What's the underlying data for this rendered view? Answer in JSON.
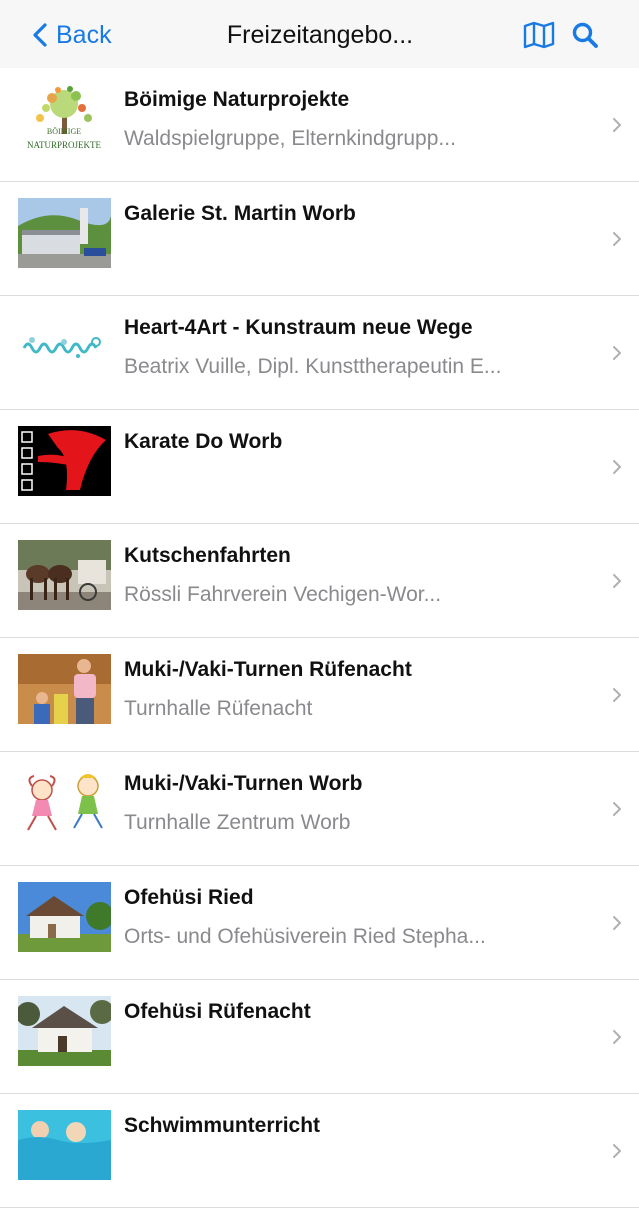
{
  "nav": {
    "back_label": "Back",
    "title": "Freizeitangebo...",
    "accent_color": "#1a7ae4",
    "icons": [
      "back-chevron-icon",
      "map-icon",
      "search-icon"
    ]
  },
  "items": [
    {
      "title": "Böimige Naturprojekte",
      "subtitle": "Waldspielgruppe, Elternkindgrupp...",
      "logo_text": [
        "BÖIMIGE",
        "NATURPROJEKTE"
      ]
    },
    {
      "title": "Galerie St. Martin Worb",
      "subtitle": ""
    },
    {
      "title": "Heart-4Art - Kunstraum neue Wege",
      "subtitle": "Beatrix Vuille, Dipl. Kunsttherapeutin E..."
    },
    {
      "title": "Karate Do Worb",
      "subtitle": ""
    },
    {
      "title": "Kutschenfahrten",
      "subtitle": "Rössli Fahrverein Vechigen-Wor..."
    },
    {
      "title": "Muki-/Vaki-Turnen Rüfenacht",
      "subtitle": "Turnhalle Rüfenacht"
    },
    {
      "title": "Muki-/Vaki-Turnen Worb",
      "subtitle": "Turnhalle Zentrum Worb"
    },
    {
      "title": "Ofehüsi Ried",
      "subtitle": "Orts- und Ofehüsiverein Ried Stepha..."
    },
    {
      "title": "Ofehüsi Rüfenacht",
      "subtitle": ""
    },
    {
      "title": "Schwimmunterricht",
      "subtitle": ""
    }
  ]
}
